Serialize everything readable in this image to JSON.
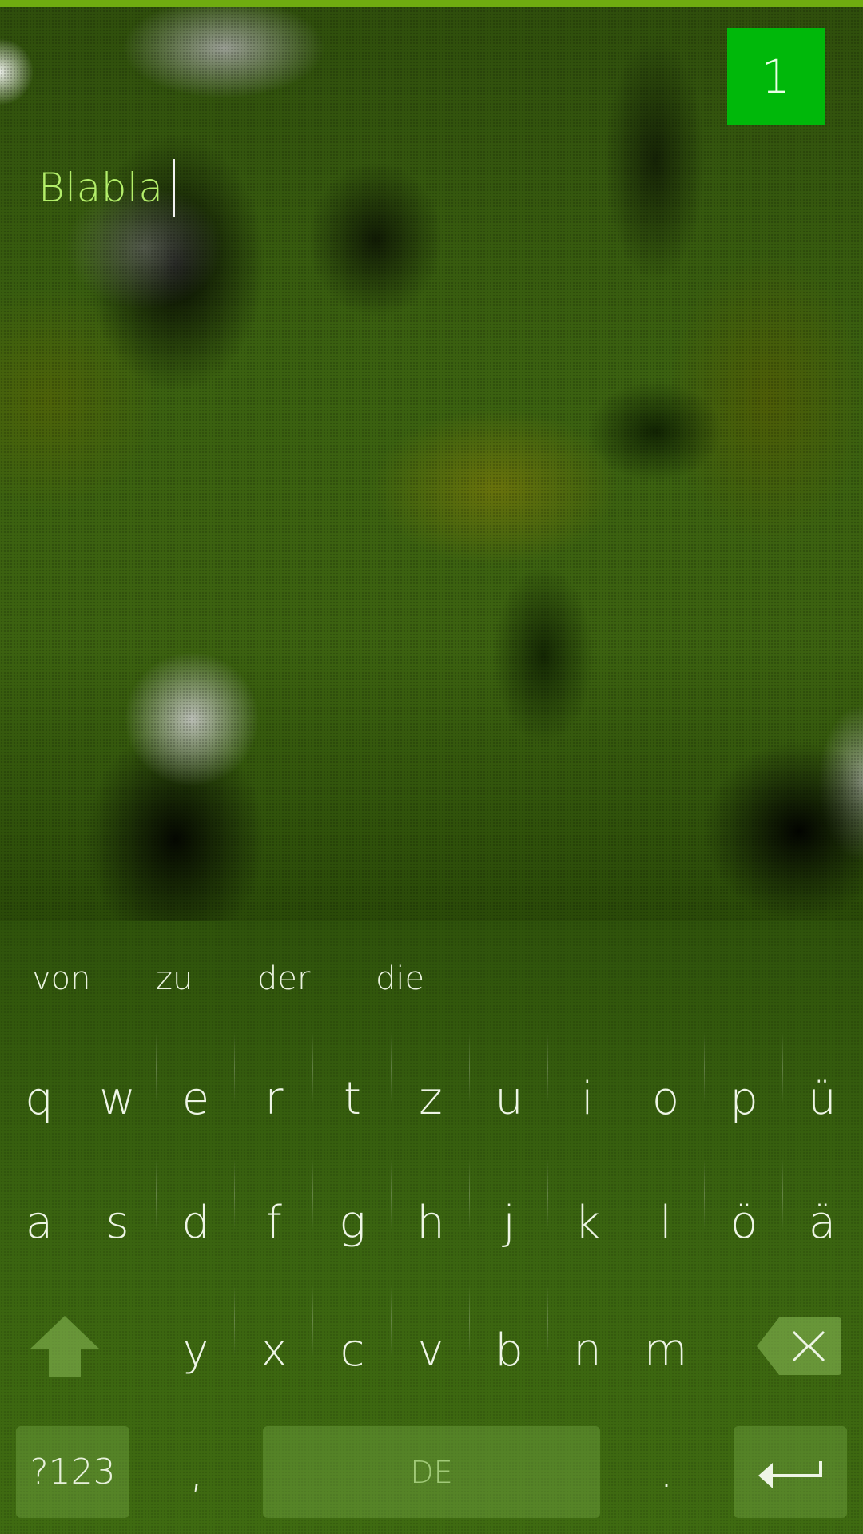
{
  "statusbar": {
    "accent_color": "#6fac10"
  },
  "counter": {
    "value": "1",
    "color": "#00b80a"
  },
  "text_field": {
    "value": "Blabla",
    "color": "#b3ee6a"
  },
  "keyboard": {
    "language": "DE",
    "suggestions": [
      "von",
      "zu",
      "der",
      "die"
    ],
    "row1": [
      "q",
      "w",
      "e",
      "r",
      "t",
      "z",
      "u",
      "i",
      "o",
      "p",
      "ü"
    ],
    "row2": [
      "a",
      "s",
      "d",
      "f",
      "g",
      "h",
      "j",
      "k",
      "l",
      "ö",
      "ä"
    ],
    "row3": [
      "y",
      "x",
      "c",
      "v",
      "b",
      "n",
      "m"
    ],
    "symbols_label": "?123",
    "comma": ",",
    "period": ".",
    "icons": {
      "shift": "shift-arrow-icon",
      "backspace": "backspace-icon",
      "enter": "enter-arrow-icon"
    }
  }
}
